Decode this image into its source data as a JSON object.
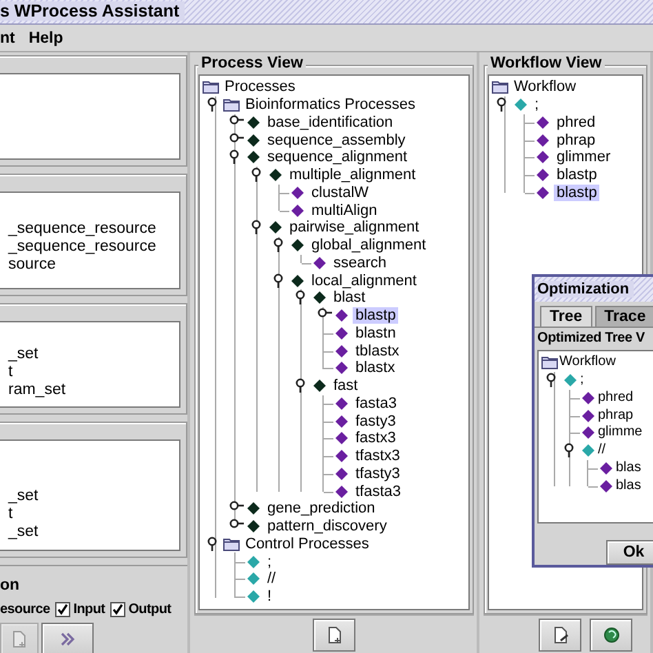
{
  "window": {
    "title": "s WProcess Assistant"
  },
  "menu": [
    {
      "label": "nt"
    },
    {
      "label": "Help"
    }
  ],
  "left_panels": [
    {
      "kind": "list"
    },
    {
      "kind": "list",
      "items": [
        "_sequence_resource",
        "_sequence_resource",
        "source"
      ]
    },
    {
      "kind": "list",
      "items": [
        "_set",
        "t",
        "ram_set"
      ]
    },
    {
      "kind": "list",
      "items": [
        "_set",
        "t",
        "_set"
      ]
    },
    {
      "kind": "options",
      "title": "on",
      "label": "esource",
      "checkboxes": [
        {
          "label": "Input",
          "checked": true
        },
        {
          "label": "Output",
          "checked": true
        }
      ],
      "buttons": [
        {
          "kind": "document",
          "disabled": true
        },
        {
          "kind": "forward",
          "disabled": false
        }
      ]
    }
  ],
  "process_view": {
    "title": "Process View",
    "tree": [
      {
        "label": "Processes",
        "kind": "folder",
        "selected": false,
        "children": [
          {
            "label": "Bioinformatics Processes",
            "kind": "folder",
            "expanded": true,
            "selected": false,
            "children": [
              {
                "label": "base_identification",
                "kind": "process",
                "expanded": false,
                "selected": false
              },
              {
                "label": "sequence_assembly",
                "kind": "process",
                "expanded": false,
                "selected": false
              },
              {
                "label": "sequence_alignment",
                "kind": "process",
                "expanded": true,
                "selected": false,
                "children": [
                  {
                    "label": "multiple_alignment",
                    "kind": "process",
                    "expanded": true,
                    "selected": false,
                    "children": [
                      {
                        "label": "clustalW",
                        "kind": "tool",
                        "selected": false
                      },
                      {
                        "label": "multiAlign",
                        "kind": "tool",
                        "selected": false
                      }
                    ]
                  },
                  {
                    "label": "pairwise_alignment",
                    "kind": "process",
                    "expanded": true,
                    "selected": false,
                    "children": [
                      {
                        "label": "global_alignment",
                        "kind": "process",
                        "expanded": true,
                        "selected": false,
                        "children": [
                          {
                            "label": "ssearch",
                            "kind": "tool",
                            "selected": false
                          }
                        ]
                      },
                      {
                        "label": "local_alignment",
                        "kind": "process",
                        "expanded": true,
                        "selected": false,
                        "children": [
                          {
                            "label": "blast",
                            "kind": "process",
                            "expanded": true,
                            "selected": false,
                            "children": [
                              {
                                "label": "blastp",
                                "kind": "tool",
                                "expanded": false,
                                "selected": true
                              },
                              {
                                "label": "blastn",
                                "kind": "tool",
                                "selected": false
                              },
                              {
                                "label": "tblastx",
                                "kind": "tool",
                                "selected": false
                              },
                              {
                                "label": "blastx",
                                "kind": "tool",
                                "selected": false
                              }
                            ]
                          },
                          {
                            "label": "fast",
                            "kind": "process",
                            "expanded": true,
                            "selected": false,
                            "children": [
                              {
                                "label": "fasta3",
                                "kind": "tool",
                                "selected": false
                              },
                              {
                                "label": "fasty3",
                                "kind": "tool",
                                "selected": false
                              },
                              {
                                "label": "fastx3",
                                "kind": "tool",
                                "selected": false
                              },
                              {
                                "label": "tfastx3",
                                "kind": "tool",
                                "selected": false
                              },
                              {
                                "label": "tfasty3",
                                "kind": "tool",
                                "selected": false
                              },
                              {
                                "label": "tfasta3",
                                "kind": "tool",
                                "selected": false
                              }
                            ]
                          }
                        ]
                      }
                    ]
                  }
                ]
              },
              {
                "label": "gene_prediction",
                "kind": "process",
                "expanded": false,
                "selected": false
              },
              {
                "label": "pattern_discovery",
                "kind": "process",
                "expanded": false,
                "selected": false
              }
            ]
          },
          {
            "label": "Control Processes",
            "kind": "folder",
            "expanded": true,
            "selected": false,
            "children": [
              {
                "label": ";",
                "kind": "control",
                "selected": false
              },
              {
                "label": "//",
                "kind": "control",
                "selected": false
              },
              {
                "label": "!",
                "kind": "control",
                "selected": false
              }
            ]
          }
        ]
      }
    ],
    "buttons": [
      {
        "kind": "document"
      }
    ]
  },
  "workflow_view": {
    "title": "Workflow View",
    "tree": [
      {
        "label": "Workflow",
        "kind": "folder",
        "selected": false,
        "children": [
          {
            "label": ";",
            "kind": "control",
            "expanded": true,
            "selected": false,
            "children": [
              {
                "label": "phred",
                "kind": "tool",
                "selected": false
              },
              {
                "label": "phrap",
                "kind": "tool",
                "selected": false
              },
              {
                "label": "glimmer",
                "kind": "tool",
                "selected": false
              },
              {
                "label": "blastp",
                "kind": "tool",
                "selected": false
              },
              {
                "label": "blastp",
                "kind": "tool",
                "selected": true
              }
            ]
          }
        ]
      }
    ],
    "buttons": [
      {
        "kind": "edit"
      },
      {
        "kind": "globe"
      }
    ]
  },
  "optimization": {
    "title": "Optimization",
    "tabs": [
      {
        "label": "Tree",
        "selected": true
      },
      {
        "label": "Trace",
        "selected": false
      }
    ],
    "group_title": "Optimized Tree V",
    "tree": [
      {
        "label": "Workflow",
        "kind": "folder",
        "selected": false,
        "children": [
          {
            "label": ";",
            "kind": "control",
            "expanded": true,
            "selected": false,
            "children": [
              {
                "label": "phred",
                "kind": "tool",
                "selected": false
              },
              {
                "label": "phrap",
                "kind": "tool",
                "selected": false
              },
              {
                "label": "glimme",
                "kind": "tool",
                "selected": false
              },
              {
                "label": "//",
                "kind": "control",
                "expanded": true,
                "selected": false,
                "children": [
                  {
                    "label": "blas",
                    "kind": "tool",
                    "selected": false
                  },
                  {
                    "label": "blas",
                    "kind": "tool",
                    "selected": false
                  }
                ]
              }
            ]
          }
        ]
      }
    ],
    "buttons": [
      {
        "label": "Ok"
      }
    ]
  }
}
